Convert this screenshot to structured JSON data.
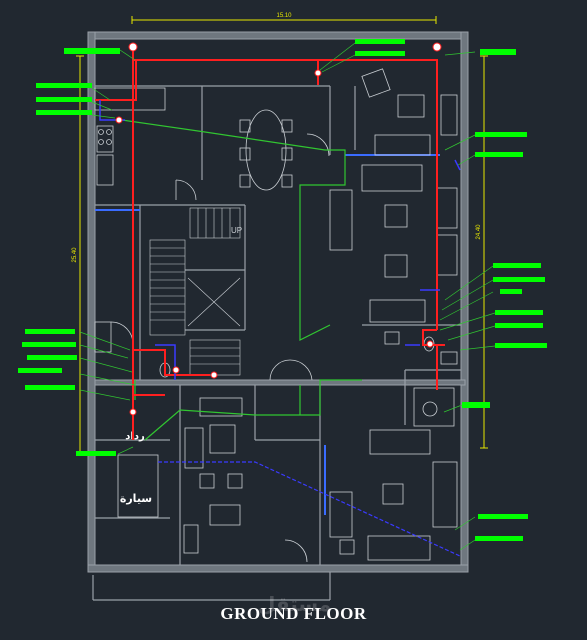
{
  "drawing": {
    "title": "GROUND FLOOR",
    "watermark": "مستقل",
    "labels": {
      "top_width": "15.10",
      "left_height": "25.40",
      "right_height": "24.40",
      "stair": "UP",
      "car_label": "سيارة",
      "meter_label": "رداد"
    },
    "colors": {
      "background": "#212830",
      "wall": "#9aa1a8",
      "furniture": "#c9ced3",
      "hot_pipe": "#ff1f1f",
      "cold_pipe": "#3a3aff",
      "drain": "#31c631",
      "callout": "#00ff00",
      "dimension": "#e8e800"
    }
  }
}
